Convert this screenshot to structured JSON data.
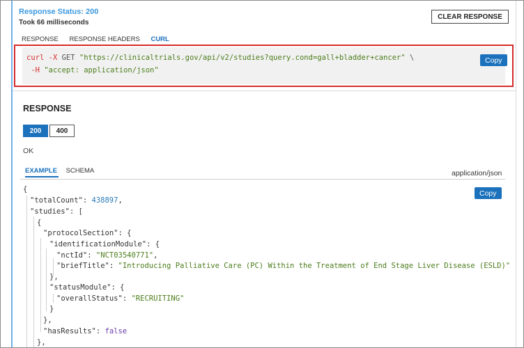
{
  "response_status": {
    "title": "Response Status: 200",
    "took": "Took 66 milliseconds",
    "clear_button": "CLEAR RESPONSE",
    "tabs": [
      "RESPONSE",
      "RESPONSE HEADERS",
      "CURL"
    ],
    "active_tab": "CURL"
  },
  "curl": {
    "cmd": "curl",
    "flag_x": "-X",
    "method": "GET",
    "url": "\"https://clinicaltrials.gov/api/v2/studies?query.cond=gall+bladder+cancer\"",
    "continuation": "\\",
    "flag_h": "-H",
    "header": "\"accept: application/json\"",
    "copy_label": "Copy"
  },
  "response": {
    "title": "RESPONSE",
    "codes": [
      "200",
      "400"
    ],
    "selected_code": "200",
    "description": "OK",
    "subtabs": [
      "EXAMPLE",
      "SCHEMA"
    ],
    "active_subtab": "EXAMPLE",
    "media_type": "application/json",
    "copy_label": "Copy"
  },
  "json_example": {
    "open_brace": "{",
    "totalCount_key": "\"totalCount\"",
    "totalCount_value": "438897",
    "studies_key": "\"studies\"",
    "protocolSection_key": "\"protocolSection\"",
    "identificationModule_key": "\"identificationModule\"",
    "nctId_key": "\"nctId\"",
    "nctId_value": "\"NCT03540771\"",
    "briefTitle_key": "\"briefTitle\"",
    "briefTitle_value": "\"Introducing Palliative Care (PC) Within the Treatment of End Stage Liver Disease (ESLD)\"",
    "statusModule_key": "\"statusModule\"",
    "overallStatus_key": "\"overallStatus\"",
    "overallStatus_value": "\"RECRUITING\"",
    "hasResults_key": "\"hasResults\"",
    "hasResults_value": "false"
  }
}
